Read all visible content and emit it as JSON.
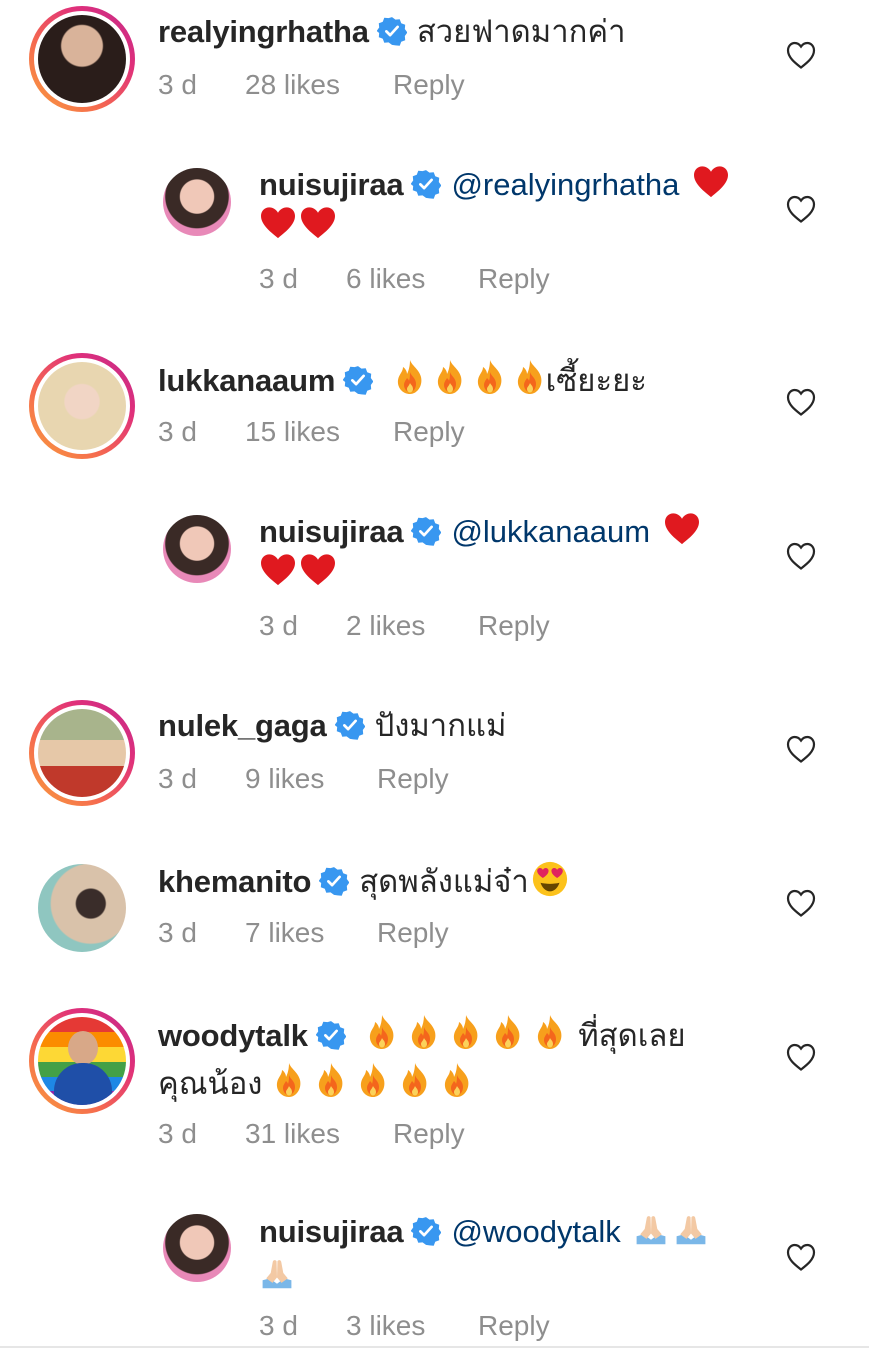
{
  "comments": [
    {
      "username": "realyingrhatha",
      "text": "สวยฟาดมากค่า",
      "time": "3 d",
      "likes": "28 likes",
      "reply": "Reply"
    },
    {
      "username": "nuisujiraa",
      "mention": "@realyingrhatha",
      "time": "3 d",
      "likes": "6 likes",
      "reply": "Reply"
    },
    {
      "username": "lukkanaaum",
      "text": "เซี้ยะยะ",
      "time": "3 d",
      "likes": "15 likes",
      "reply": "Reply"
    },
    {
      "username": "nuisujiraa",
      "mention": "@lukkanaaum",
      "time": "3 d",
      "likes": "2 likes",
      "reply": "Reply"
    },
    {
      "username": "nulek_gaga",
      "text": "ปังมากแม่",
      "time": "3 d",
      "likes": "9 likes",
      "reply": "Reply"
    },
    {
      "username": "khemanito",
      "text": "สุดพลังแม่จ๋า",
      "time": "3 d",
      "likes": "7 likes",
      "reply": "Reply"
    },
    {
      "username": "woodytalk",
      "text": "ที่สุดเลย",
      "text2": "คุณน้อง",
      "time": "3 d",
      "likes": "31 likes",
      "reply": "Reply"
    },
    {
      "username": "nuisujiraa",
      "mention": "@woodytalk",
      "time": "3 d",
      "likes": "3 likes",
      "reply": "Reply"
    }
  ],
  "icons": {
    "verified": "verified-badge-icon",
    "like": "heart-outline-icon",
    "fire": "fire-emoji",
    "heart_red": "red-heart-emoji",
    "heart_eyes": "heart-eyes-emoji",
    "pray": "folded-hands-emoji"
  },
  "colors": {
    "text": "#262626",
    "meta": "#8e8e8e",
    "mention": "#00376b",
    "verified": "#3897f0",
    "story_ring_start": "#f9a03c",
    "story_ring_end": "#c12a8c"
  }
}
